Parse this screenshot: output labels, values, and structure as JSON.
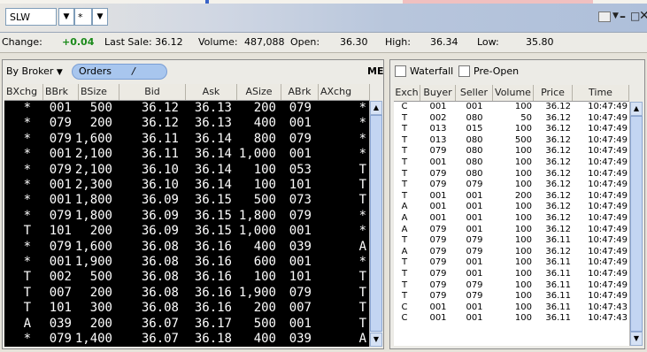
{
  "toolbar": {
    "symbol": "SLW",
    "star_value": "*"
  },
  "quote": {
    "change_label": "Change:",
    "change_value": "+0.04",
    "last_sale": "Last Sale: 36.12",
    "volume_label": "Volume:",
    "volume_value": "487,088",
    "open_label": "Open:",
    "open_value": "36.30",
    "high_label": "High:",
    "high_value": "36.34",
    "low_label": "Low:",
    "low_value": "35.80"
  },
  "book": {
    "by_broker": "By Broker",
    "orders": "Orders",
    "slash": "/",
    "me": "ME",
    "columns": [
      "BXchg",
      "BBrk",
      "BSize",
      "Bid",
      "Ask",
      "ASize",
      "ABrk",
      "AXchg"
    ],
    "rows": [
      [
        "*",
        "001",
        "500",
        "36.12",
        "36.13",
        "200",
        "079",
        "*"
      ],
      [
        "*",
        "079",
        "200",
        "36.12",
        "36.13",
        "400",
        "001",
        "*"
      ],
      [
        "*",
        "079",
        "1,600",
        "36.11",
        "36.14",
        "800",
        "079",
        "*"
      ],
      [
        "*",
        "001",
        "2,100",
        "36.11",
        "36.14",
        "1,000",
        "001",
        "*"
      ],
      [
        "*",
        "079",
        "2,100",
        "36.10",
        "36.14",
        "100",
        "053",
        "T"
      ],
      [
        "*",
        "001",
        "2,300",
        "36.10",
        "36.14",
        "100",
        "101",
        "T"
      ],
      [
        "*",
        "001",
        "1,800",
        "36.09",
        "36.15",
        "500",
        "073",
        "T"
      ],
      [
        "*",
        "079",
        "1,800",
        "36.09",
        "36.15",
        "1,800",
        "079",
        "*"
      ],
      [
        "T",
        "101",
        "200",
        "36.09",
        "36.15",
        "1,000",
        "001",
        "*"
      ],
      [
        "*",
        "079",
        "1,600",
        "36.08",
        "36.16",
        "400",
        "039",
        "A"
      ],
      [
        "*",
        "001",
        "1,900",
        "36.08",
        "36.16",
        "600",
        "001",
        "*"
      ],
      [
        "T",
        "002",
        "500",
        "36.08",
        "36.16",
        "100",
        "101",
        "T"
      ],
      [
        "T",
        "007",
        "200",
        "36.08",
        "36.16",
        "1,900",
        "079",
        "T"
      ],
      [
        "T",
        "101",
        "300",
        "36.08",
        "36.16",
        "200",
        "007",
        "T"
      ],
      [
        "A",
        "039",
        "200",
        "36.07",
        "36.17",
        "500",
        "001",
        "T"
      ],
      [
        "*",
        "079",
        "1,400",
        "36.07",
        "36.18",
        "400",
        "039",
        "A"
      ]
    ]
  },
  "tape": {
    "waterfall_label": "Waterfall",
    "preopen_label": "Pre-Open",
    "columns": [
      "Exch",
      "Buyer",
      "Seller",
      "Volume",
      "Price",
      "Time"
    ],
    "rows": [
      [
        "C",
        "001",
        "001",
        "100",
        "36.12",
        "10:47:49"
      ],
      [
        "T",
        "002",
        "080",
        "50",
        "36.12",
        "10:47:49"
      ],
      [
        "T",
        "013",
        "015",
        "100",
        "36.12",
        "10:47:49"
      ],
      [
        "T",
        "013",
        "080",
        "500",
        "36.12",
        "10:47:49"
      ],
      [
        "T",
        "079",
        "080",
        "100",
        "36.12",
        "10:47:49"
      ],
      [
        "T",
        "001",
        "080",
        "100",
        "36.12",
        "10:47:49"
      ],
      [
        "T",
        "079",
        "080",
        "100",
        "36.12",
        "10:47:49"
      ],
      [
        "T",
        "079",
        "079",
        "100",
        "36.12",
        "10:47:49"
      ],
      [
        "T",
        "001",
        "001",
        "200",
        "36.12",
        "10:47:49"
      ],
      [
        "A",
        "001",
        "001",
        "100",
        "36.12",
        "10:47:49"
      ],
      [
        "A",
        "001",
        "001",
        "100",
        "36.12",
        "10:47:49"
      ],
      [
        "A",
        "079",
        "001",
        "100",
        "36.12",
        "10:47:49"
      ],
      [
        "T",
        "079",
        "079",
        "100",
        "36.11",
        "10:47:49"
      ],
      [
        "A",
        "079",
        "079",
        "100",
        "36.12",
        "10:47:49"
      ],
      [
        "T",
        "079",
        "001",
        "100",
        "36.11",
        "10:47:49"
      ],
      [
        "T",
        "079",
        "001",
        "100",
        "36.11",
        "10:47:49"
      ],
      [
        "T",
        "079",
        "079",
        "100",
        "36.11",
        "10:47:49"
      ],
      [
        "T",
        "079",
        "079",
        "100",
        "36.11",
        "10:47:49"
      ],
      [
        "C",
        "001",
        "001",
        "100",
        "36.11",
        "10:47:43"
      ],
      [
        "C",
        "001",
        "001",
        "100",
        "36.11",
        "10:47:43"
      ]
    ]
  },
  "icons": {
    "dropdown": "chevron-down-icon",
    "minimize": "minimize-icon",
    "maximize": "maximize-icon",
    "close": "close-icon",
    "scroll_up": "arrow-up-icon",
    "scroll_down": "arrow-down-icon"
  },
  "colors": {
    "change_positive": "#1a8a1a",
    "orders_pill": "#a8c6ee",
    "book_background": "#000000"
  }
}
